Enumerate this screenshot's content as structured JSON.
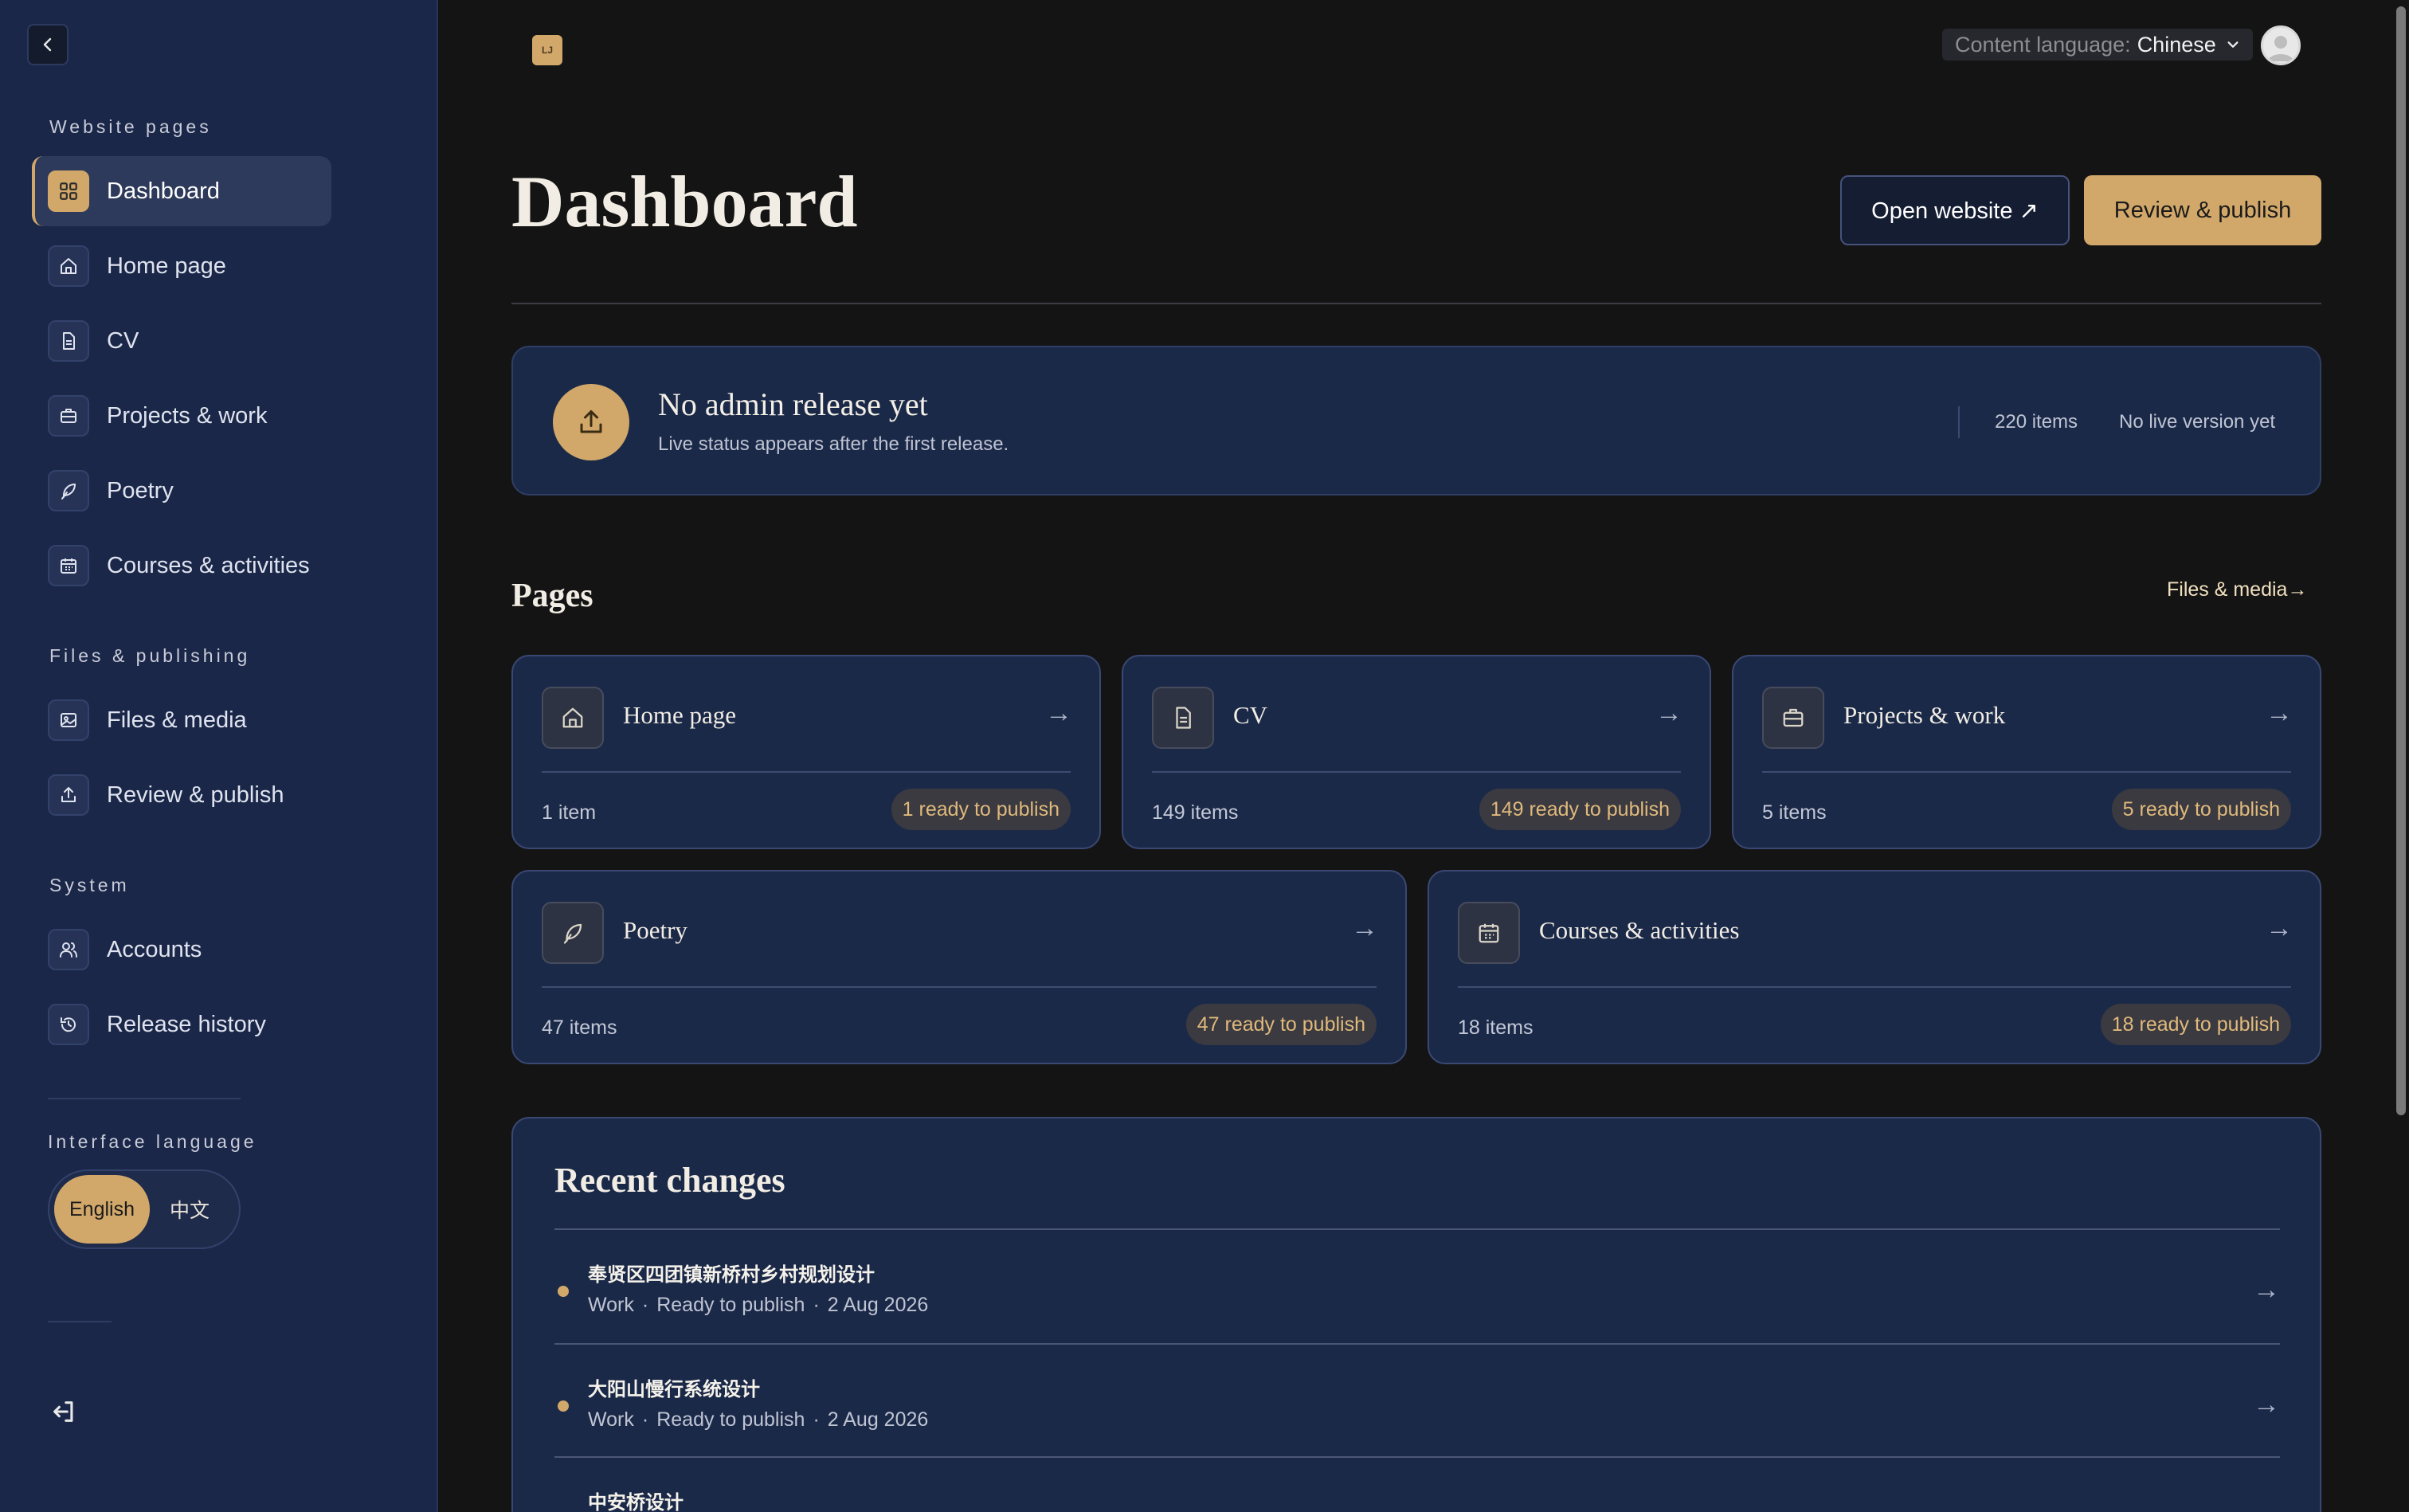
{
  "sidebar": {
    "sections": {
      "website_pages": "Website pages",
      "files_publishing": "Files & publishing",
      "system": "System",
      "interface_language": "Interface language"
    },
    "items": [
      {
        "label": "Dashboard",
        "icon": "grid-icon",
        "active": true
      },
      {
        "label": "Home page",
        "icon": "home-icon"
      },
      {
        "label": "CV",
        "icon": "document-icon"
      },
      {
        "label": "Projects & work",
        "icon": "briefcase-icon"
      },
      {
        "label": "Poetry",
        "icon": "feather-icon"
      },
      {
        "label": "Courses & activities",
        "icon": "calendar-icon"
      },
      {
        "label": "Files & media",
        "icon": "image-icon"
      },
      {
        "label": "Review & publish",
        "icon": "upload-icon"
      },
      {
        "label": "Accounts",
        "icon": "users-icon"
      },
      {
        "label": "Release history",
        "icon": "history-icon"
      }
    ],
    "language": {
      "english": "English",
      "chinese": "中文",
      "selected": "English"
    }
  },
  "topbar": {
    "logo_text": "LJ",
    "content_language_label": "Content language:",
    "content_language_value": "Chinese"
  },
  "header": {
    "title": "Dashboard",
    "open_website": "Open website ↗",
    "review_publish": "Review & publish"
  },
  "release": {
    "title": "No admin release yet",
    "subtitle": "Live status appears after the first release.",
    "items": "220 items",
    "live": "No live version yet"
  },
  "pages": {
    "title": "Pages",
    "files_link": "Files & media→",
    "cards": [
      {
        "title": "Home page",
        "count": "1 item",
        "badge": "1 ready to publish",
        "icon": "home-icon"
      },
      {
        "title": "CV",
        "count": "149 items",
        "badge": "149 ready to publish",
        "icon": "document-icon"
      },
      {
        "title": "Projects & work",
        "count": "5 items",
        "badge": "5 ready to publish",
        "icon": "briefcase-icon"
      },
      {
        "title": "Poetry",
        "count": "47 items",
        "badge": "47 ready to publish",
        "icon": "feather-icon"
      },
      {
        "title": "Courses & activities",
        "count": "18 items",
        "badge": "18 ready to publish",
        "icon": "calendar-icon"
      }
    ]
  },
  "recent": {
    "title": "Recent changes",
    "items": [
      {
        "title": "奉贤区四团镇新桥村乡村规划设计",
        "type": "Work",
        "status": "Ready to publish",
        "date": "2 Aug 2026"
      },
      {
        "title": "大阳山慢行系统设计",
        "type": "Work",
        "status": "Ready to publish",
        "date": "2 Aug 2026"
      },
      {
        "title": "中安桥设计",
        "type": "",
        "status": "",
        "date": ""
      }
    ],
    "separator": "·"
  },
  "arrow": "→",
  "colors": {
    "accent": "#d2a86a",
    "panel": "#1b2949",
    "sidebar": "#1a2749",
    "background": "#141414"
  }
}
